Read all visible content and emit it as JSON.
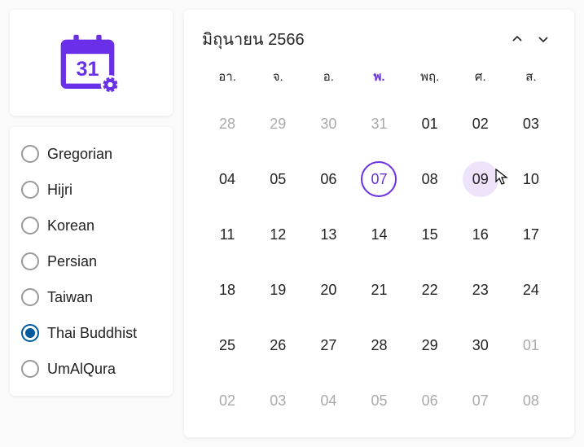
{
  "logo": {
    "text": "31"
  },
  "calendarTypes": [
    {
      "label": "Gregorian",
      "selected": false
    },
    {
      "label": "Hijri",
      "selected": false
    },
    {
      "label": "Korean",
      "selected": false
    },
    {
      "label": "Persian",
      "selected": false
    },
    {
      "label": "Taiwan",
      "selected": false
    },
    {
      "label": "Thai Buddhist",
      "selected": true
    },
    {
      "label": "UmAlQura",
      "selected": false
    }
  ],
  "calendar": {
    "title": "มิถุนายน 2566",
    "weekdays": [
      {
        "label": "อา.",
        "highlight": false
      },
      {
        "label": "จ.",
        "highlight": false
      },
      {
        "label": "อ.",
        "highlight": false
      },
      {
        "label": "พ.",
        "highlight": true
      },
      {
        "label": "พฤ.",
        "highlight": false
      },
      {
        "label": "ศ.",
        "highlight": false
      },
      {
        "label": "ส.",
        "highlight": false
      }
    ],
    "days": [
      {
        "n": "28",
        "other": true
      },
      {
        "n": "29",
        "other": true
      },
      {
        "n": "30",
        "other": true
      },
      {
        "n": "31",
        "other": true
      },
      {
        "n": "01"
      },
      {
        "n": "02"
      },
      {
        "n": "03"
      },
      {
        "n": "04"
      },
      {
        "n": "05"
      },
      {
        "n": "06"
      },
      {
        "n": "07",
        "today": true
      },
      {
        "n": "08"
      },
      {
        "n": "09",
        "hover": true
      },
      {
        "n": "10"
      },
      {
        "n": "11"
      },
      {
        "n": "12"
      },
      {
        "n": "13"
      },
      {
        "n": "14"
      },
      {
        "n": "15"
      },
      {
        "n": "16"
      },
      {
        "n": "17"
      },
      {
        "n": "18"
      },
      {
        "n": "19"
      },
      {
        "n": "20"
      },
      {
        "n": "21"
      },
      {
        "n": "22"
      },
      {
        "n": "23"
      },
      {
        "n": "24"
      },
      {
        "n": "25"
      },
      {
        "n": "26"
      },
      {
        "n": "27"
      },
      {
        "n": "28"
      },
      {
        "n": "29"
      },
      {
        "n": "30"
      },
      {
        "n": "01",
        "other": true
      },
      {
        "n": "02",
        "other": true
      },
      {
        "n": "03",
        "other": true
      },
      {
        "n": "04",
        "other": true
      },
      {
        "n": "05",
        "other": true
      },
      {
        "n": "06",
        "other": true
      },
      {
        "n": "07",
        "other": true
      },
      {
        "n": "08",
        "other": true
      }
    ]
  }
}
